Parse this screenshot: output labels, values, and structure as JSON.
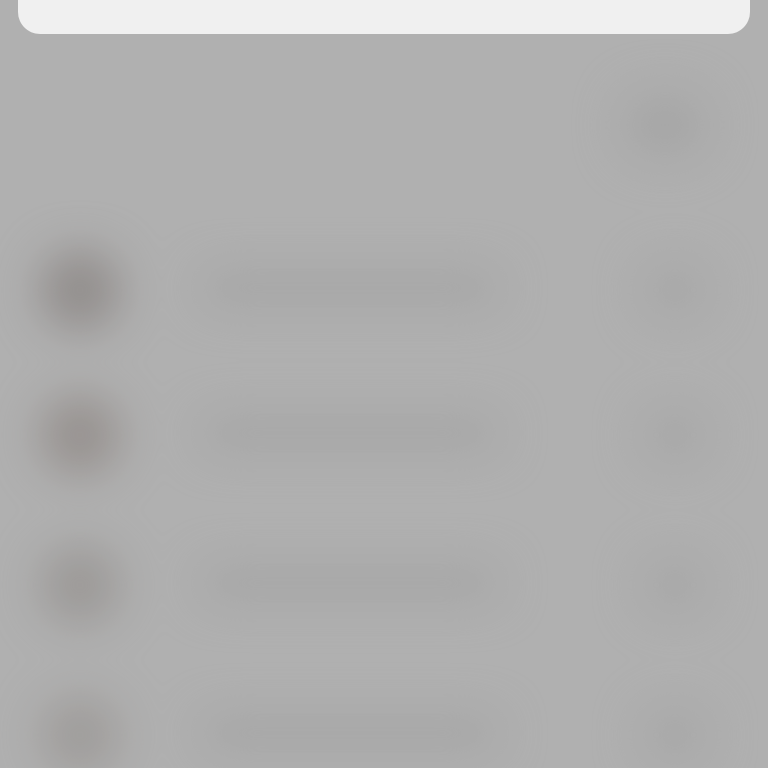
{
  "background": {
    "base_color": "#b3b3b3",
    "rows": [
      {
        "avatar_color": "#8f8a88"
      },
      {
        "avatar_color": "#958f8c"
      },
      {
        "avatar_color": "#9b9896"
      },
      {
        "avatar_color": "#9f9c9a"
      }
    ]
  },
  "top_card": {
    "color": "#f0f0f0",
    "text": ""
  }
}
